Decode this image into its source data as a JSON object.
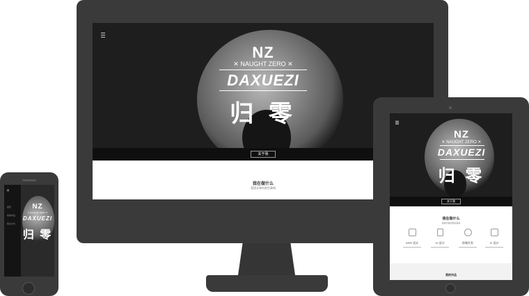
{
  "brand": {
    "mark": "NZ",
    "tagline": "✕ NAUGHT ZERO ✕",
    "name": "DAXUEZI",
    "name_cn": "归 零"
  },
  "desktop": {
    "about_button": "关于我",
    "section_title": "我在做什么",
    "section_subtitle": "我擅长做的那些事情"
  },
  "tablet": {
    "about_button": "关于我",
    "section_title": "我在做什么",
    "section_subtitle": "我擅长做的那些事情",
    "services": [
      {
        "label": "WEB 设计",
        "icon": "monitor-icon"
      },
      {
        "label": "UI 设计",
        "icon": "tablet-icon"
      },
      {
        "label": "前端开发",
        "icon": "bulb-icon"
      },
      {
        "label": "VI 设计",
        "icon": "mail-icon"
      }
    ],
    "footer_title": "我的作品"
  },
  "phone": {
    "close_glyph": "✕",
    "menu_items": [
      "首页",
      "我的作品",
      "联系方式"
    ]
  },
  "colors": {
    "device": "#3a3a3a",
    "hero_bg": "#1e1e1e",
    "bar": "#0f0f0f"
  }
}
